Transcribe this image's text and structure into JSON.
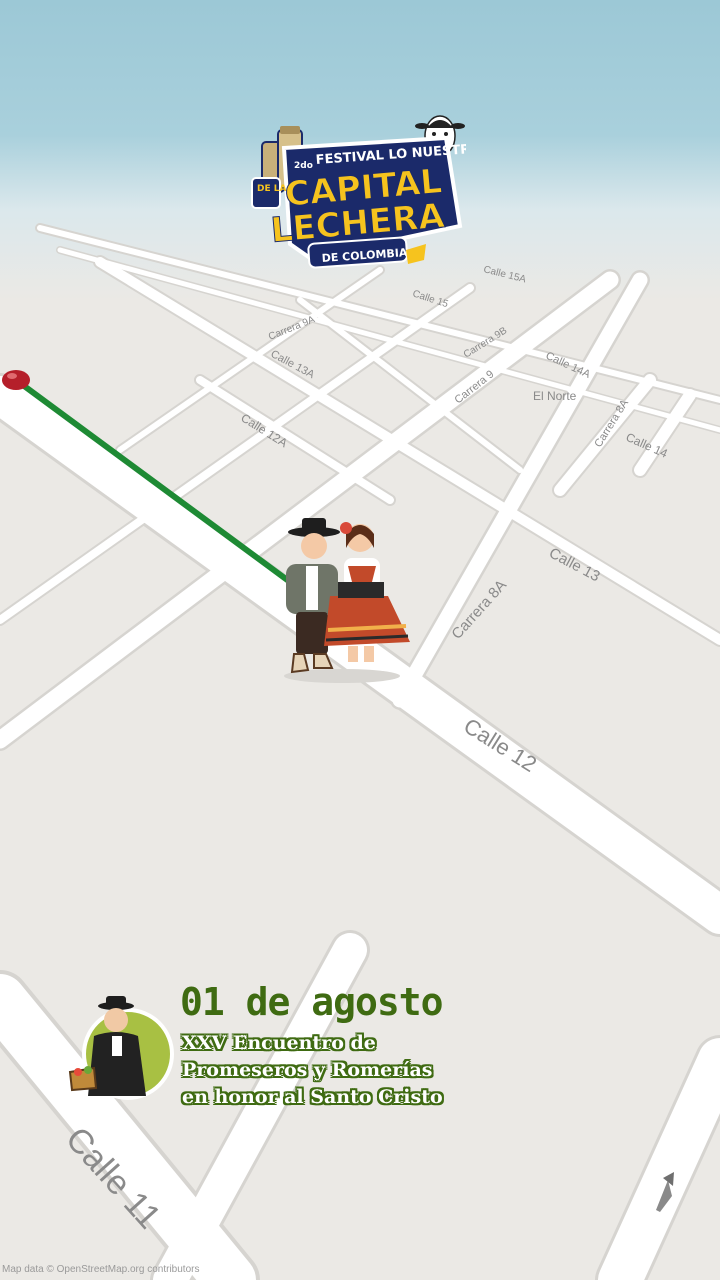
{
  "map": {
    "streets": {
      "calle_15a": "Calle 15A",
      "calle_15": "Calle 15",
      "carrera_9a": "Carrera 9A",
      "carrera_9b": "Carrera 9B",
      "calle_13a": "Calle 13A",
      "calle_14a": "Calle 14A",
      "carrera_9": "Carrera 9",
      "el_norte": "El Norte",
      "carrera_8a_top": "Carrera 8A",
      "calle_14": "Calle 14",
      "calle_12a": "Calle 12A",
      "calle_13": "Calle 13",
      "carrera_8a": "Carrera 8A",
      "calle_12": "Calle 12",
      "calle_11": "Calle 11"
    },
    "route_color": "#1e8a34",
    "marker_color": "#b51f2a",
    "attribution": "Map data © OpenStreetMap.org contributors"
  },
  "logo": {
    "line1_sup": "2do",
    "line1": "FESTIVAL LO NUESTRO",
    "de_la": "DE LA",
    "capital": "CAPITAL",
    "lechera": "LECHERA",
    "de_colombia": "DE COLOMBIA"
  },
  "event": {
    "date": "01 de agosto",
    "title_lines": [
      "XXV Encuentro de",
      "Promeseros y Romerías",
      "en honor al Santo Cristo"
    ],
    "accent_color": "#3f6b12"
  }
}
